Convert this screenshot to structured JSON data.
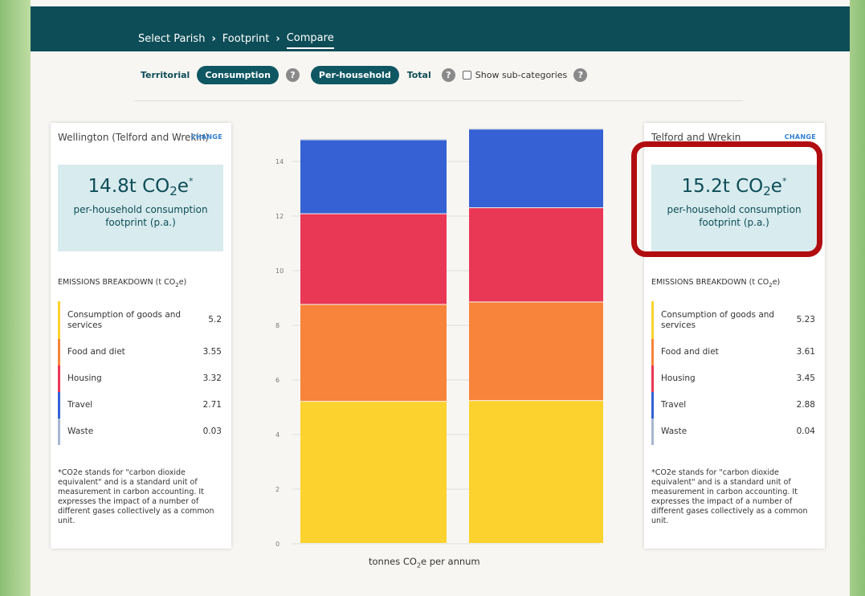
{
  "nav": {
    "crumbs": [
      "Select Parish",
      "Footprint",
      "Compare"
    ],
    "separator": "›"
  },
  "filters": {
    "territorial": "Territorial",
    "consumption": "Consumption",
    "per_household": "Per-household",
    "total": "Total",
    "show_subcategories": "Show sub-categories",
    "help_glyph": "?"
  },
  "left": {
    "title": "Wellington (Telford and Wrekin)",
    "change": "CHANGE",
    "footprint_value": "14.8t CO",
    "footprint_sub": "2",
    "footprint_suffix": "e",
    "footprint_sup": "*",
    "footprint_desc": "per-household consumption footprint (p.a.)",
    "breakdown_title": "EMISSIONS BREAKDOWN (t CO",
    "breakdown_sub": "2",
    "breakdown_suffix": "e)",
    "items": [
      {
        "label": "Consumption of goods and services",
        "value": "5.2"
      },
      {
        "label": "Food and diet",
        "value": "3.55"
      },
      {
        "label": "Housing",
        "value": "3.32"
      },
      {
        "label": "Travel",
        "value": "2.71"
      },
      {
        "label": "Waste",
        "value": "0.03"
      }
    ],
    "note": "*CO2e stands for \"carbon dioxide equivalent\" and is a standard unit of measurement in carbon accounting. It expresses the impact of a number of different gases collectively as a common unit."
  },
  "right": {
    "title": "Telford and Wrekin",
    "change": "CHANGE",
    "footprint_value": "15.2t CO",
    "footprint_sub": "2",
    "footprint_suffix": "e",
    "footprint_sup": "*",
    "footprint_desc": "per-household consumption footprint (p.a.)",
    "breakdown_title": "EMISSIONS BREAKDOWN (t CO",
    "breakdown_sub": "2",
    "breakdown_suffix": "e)",
    "items": [
      {
        "label": "Consumption of goods and services",
        "value": "5.23"
      },
      {
        "label": "Food and diet",
        "value": "3.61"
      },
      {
        "label": "Housing",
        "value": "3.45"
      },
      {
        "label": "Travel",
        "value": "2.88"
      },
      {
        "label": "Waste",
        "value": "0.04"
      }
    ],
    "note": "*CO2e stands for \"carbon dioxide equivalent\" and is a standard unit of measurement in carbon accounting. It expresses the impact of a number of different gases collectively as a common unit."
  },
  "category_colors": {
    "consumption": "#fcd22e",
    "food": "#f7843a",
    "housing": "#e93756",
    "travel": "#3561d4",
    "waste": "#a9b6d0"
  },
  "accent": {
    "teal": "#0d4d57",
    "highlight": "#b10d10",
    "link": "#2f7fd4"
  },
  "chart_data": {
    "type": "bar",
    "stacked": true,
    "categories": [
      "Wellington (Telford and Wrekin)",
      "Telford and Wrekin"
    ],
    "series": [
      {
        "name": "Consumption of goods and services",
        "values": [
          5.2,
          5.23
        ]
      },
      {
        "name": "Food and diet",
        "values": [
          3.55,
          3.61
        ]
      },
      {
        "name": "Housing",
        "values": [
          3.32,
          3.45
        ]
      },
      {
        "name": "Travel",
        "values": [
          2.71,
          2.88
        ]
      },
      {
        "name": "Waste",
        "values": [
          0.03,
          0.04
        ]
      }
    ],
    "yticks": [
      0,
      2,
      4,
      6,
      8,
      10,
      12,
      14
    ],
    "ylim": [
      0,
      15.2
    ],
    "xlabel_main": "tonnes CO",
    "xlabel_sub": "2",
    "xlabel_suffix": "e per annum",
    "grid": true
  }
}
